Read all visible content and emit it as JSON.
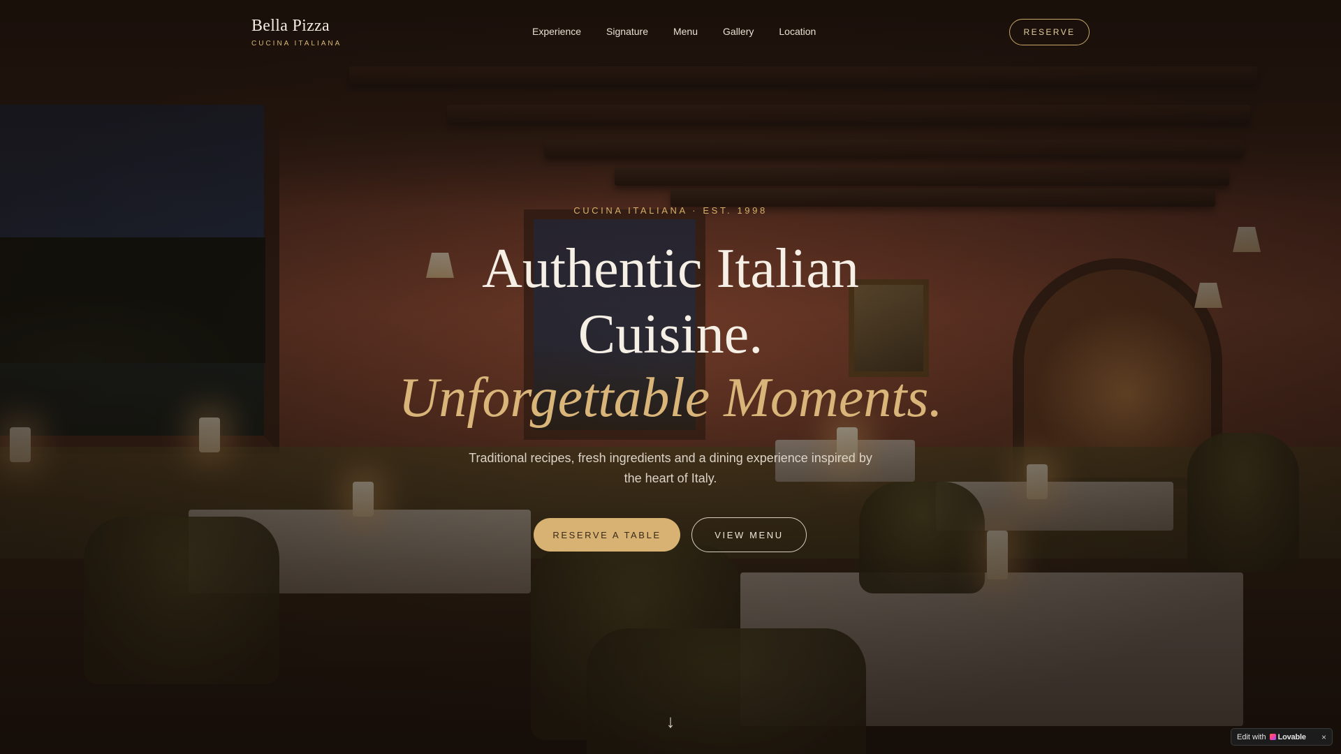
{
  "header": {
    "logo_title": "Bella Pizza",
    "logo_sub": "CUCINA ITALIANA",
    "nav": [
      {
        "label": "Experience"
      },
      {
        "label": "Signature"
      },
      {
        "label": "Menu"
      },
      {
        "label": "Gallery"
      },
      {
        "label": "Location"
      }
    ],
    "reserve_label": "RESERVE"
  },
  "hero": {
    "eyebrow": "CUCINA ITALIANA · EST. 1998",
    "headline_line1": "Authentic Italian",
    "headline_line2": "Cuisine.",
    "tagline": "Unforgettable Moments.",
    "subtext": "Traditional recipes, fresh ingredients and a dining experience inspired by the heart of Italy.",
    "cta_primary": "RESERVE A TABLE",
    "cta_secondary": "VIEW MENU",
    "scroll_arrow": "↓"
  },
  "badge": {
    "edit_text": "Edit with",
    "brand": "Lovable",
    "close": "×"
  },
  "colors": {
    "accent_gold": "#d7b273",
    "text_light": "#f5efe6",
    "eyebrow_gold": "#d6b06a"
  },
  "icons": [
    "arrow-down-icon",
    "lovable-heart-icon",
    "close-icon"
  ]
}
